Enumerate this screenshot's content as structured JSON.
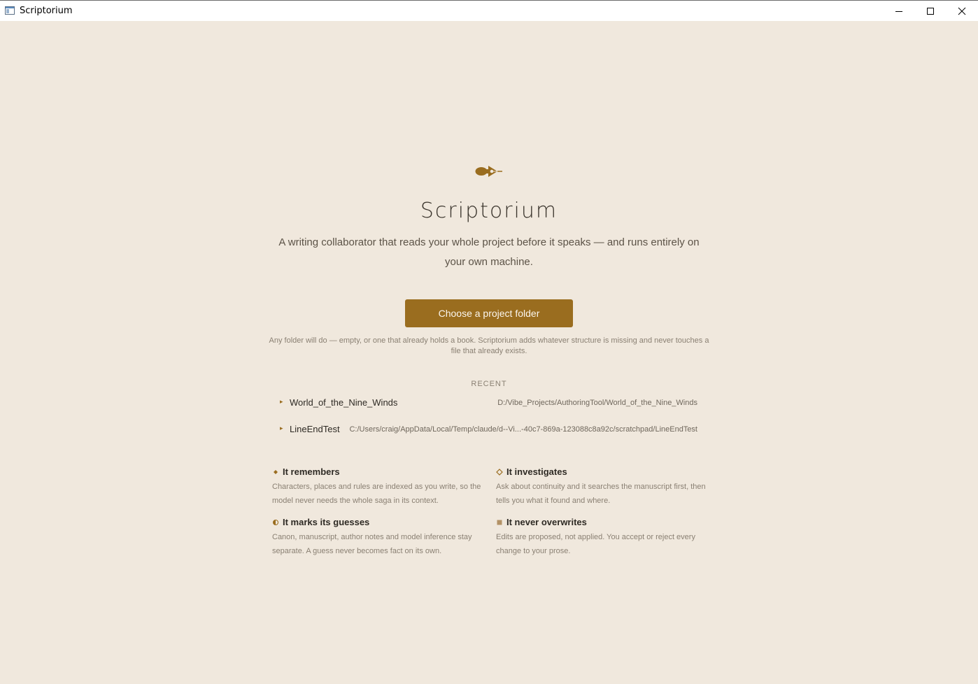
{
  "window": {
    "title": "Scriptorium"
  },
  "app": {
    "name": "Scriptorium",
    "tagline": "A writing collaborator that reads your whole project before it speaks — and runs entirely on your own machine.",
    "choose_button": "Choose a project folder",
    "hint": "Any folder will do — empty, or one that already holds a book. Scriptorium adds whatever structure is missing and never touches a file that already exists."
  },
  "recent": {
    "label": "RECENT",
    "items": [
      {
        "name": "World_of_the_Nine_Winds",
        "path": "D:/Vibe_Projects/AuthoringTool/World_of_the_Nine_Winds"
      },
      {
        "name": "LineEndTest",
        "path": "C:/Users/craig/AppData/Local/Temp/claude/d--Vi...-40c7-869a-123088c8a92c/scratchpad/LineEndTest"
      }
    ]
  },
  "features": [
    {
      "icon": "diamond-filled-icon",
      "title": "It remembers",
      "description": "Characters, places and rules are indexed as you write, so the model never needs the whole saga in its context."
    },
    {
      "icon": "diamond-outline-icon",
      "title": "It investigates",
      "description": "Ask about continuity and it searches the manuscript first, then tells you what it found and where."
    },
    {
      "icon": "half-circle-icon",
      "title": "It marks its guesses",
      "description": "Canon, manuscript, author notes and model inference stay separate. A guess never becomes fact on its own."
    },
    {
      "icon": "square-icon",
      "title": "It never overwrites",
      "description": "Edits are proposed, not applied. You accept or reject every change to your prose."
    }
  ],
  "colors": {
    "background": "#f0e8dd",
    "accent": "#9a6d1f",
    "text_primary": "#2e2a24",
    "text_muted": "#8a8073"
  }
}
